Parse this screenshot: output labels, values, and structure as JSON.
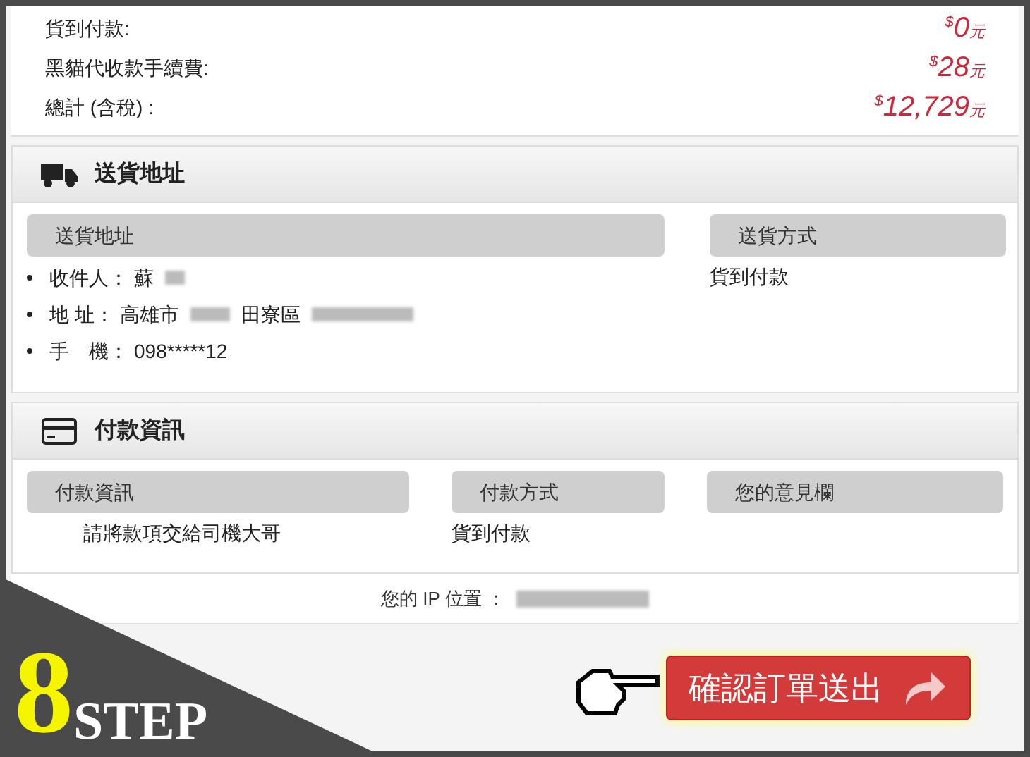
{
  "totals": [
    {
      "label": "貨到付款:",
      "currency": "$",
      "amount": "0",
      "unit": "元"
    },
    {
      "label": "黑貓代收款手續費:",
      "currency": "$",
      "amount": "28",
      "unit": "元"
    },
    {
      "label": "總計 (含稅) :",
      "currency": "$",
      "amount": "12,729",
      "unit": "元"
    }
  ],
  "shipping": {
    "title": "送貨地址",
    "columns": [
      {
        "heading": "送貨地址",
        "lines": [
          {
            "label": "收件人：",
            "parts": [
              "蘇"
            ],
            "redacted": true
          },
          {
            "label": "地 址：",
            "parts": [
              "高雄市",
              "田寮區"
            ],
            "redacted": true
          },
          {
            "label": "手　機：",
            "parts": [
              "098*****12"
            ],
            "redacted": false
          }
        ]
      },
      {
        "heading": "送貨方式",
        "text": "貨到付款"
      }
    ]
  },
  "payment": {
    "title": "付款資訊",
    "columns": [
      {
        "heading": "付款資訊",
        "text": "請將款項交給司機大哥"
      },
      {
        "heading": "付款方式",
        "text": "貨到付款"
      },
      {
        "heading": "您的意見欄",
        "text": ""
      }
    ]
  },
  "ip": {
    "label": "您的 IP 位置 ："
  },
  "submit": {
    "label": "確認訂單送出"
  },
  "step": {
    "number": "8",
    "word": "STEP"
  }
}
